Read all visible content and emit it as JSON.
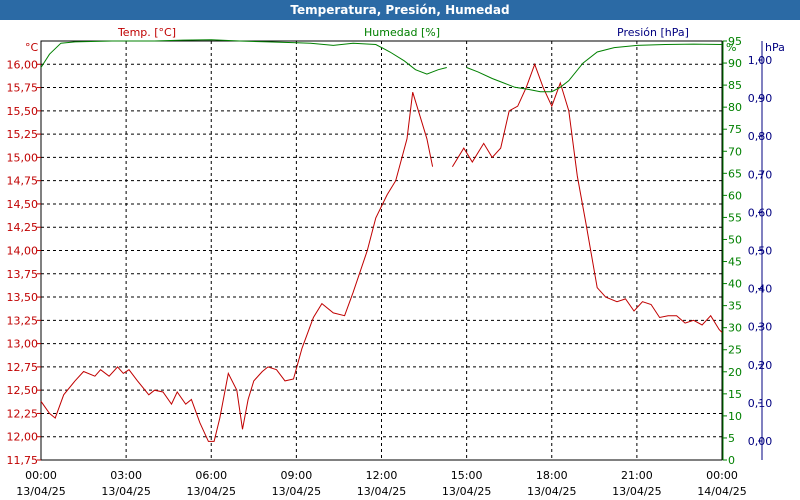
{
  "window": {
    "title": "Temperatura, Presión, Humedad"
  },
  "legend": {
    "temp": "Temp. [°C]",
    "hum": "Humedad [%]",
    "pres": "Presión [hPa]"
  },
  "units": {
    "temp": "°C",
    "hum": "%",
    "pres": "hPa"
  },
  "colors": {
    "temp": "#c00000",
    "hum": "#008000",
    "pres": "#000080",
    "title_bg": "#2b6aa5",
    "grid": "#000000"
  },
  "chart_data": {
    "type": "line",
    "title": "Temperatura, Presión, Humedad",
    "x_ticks": [
      {
        "time": "00:00",
        "date": "13/04/25"
      },
      {
        "time": "03:00",
        "date": "13/04/25"
      },
      {
        "time": "06:00",
        "date": "13/04/25"
      },
      {
        "time": "09:00",
        "date": "13/04/25"
      },
      {
        "time": "12:00",
        "date": "13/04/25"
      },
      {
        "time": "15:00",
        "date": "13/04/25"
      },
      {
        "time": "18:00",
        "date": "13/04/25"
      },
      {
        "time": "21:00",
        "date": "13/04/25"
      },
      {
        "time": "00:00",
        "date": "14/04/25"
      }
    ],
    "xlim_hours": [
      0,
      24
    ],
    "y_left": {
      "label": "Temp. [°C]",
      "unit": "°C",
      "lim": [
        11.75,
        16.25
      ],
      "ticks": [
        "11,75",
        "12,00",
        "12,25",
        "12,50",
        "12,75",
        "13,00",
        "13,25",
        "13,50",
        "13,75",
        "14,00",
        "14,25",
        "14,50",
        "14,75",
        "15,00",
        "15,25",
        "15,50",
        "15,75",
        "16,00"
      ]
    },
    "y_right1": {
      "label": "Humedad [%]",
      "unit": "%",
      "lim": [
        0,
        95
      ],
      "ticks": [
        "0",
        "5",
        "10",
        "15",
        "20",
        "25",
        "30",
        "35",
        "40",
        "45",
        "50",
        "55",
        "60",
        "65",
        "70",
        "75",
        "80",
        "85",
        "90",
        "95"
      ]
    },
    "y_right2": {
      "label": "Presión [hPa]",
      "unit": "hPa",
      "ticks": [
        "0,00",
        "0,10",
        "0,20",
        "0,30",
        "0,40",
        "0,50",
        "0,60",
        "0,70",
        "0,80",
        "0,90",
        "1,00"
      ]
    },
    "series": [
      {
        "name": "Temp. [°C]",
        "axis": "temp",
        "segments": [
          [
            [
              0.0,
              12.38
            ],
            [
              0.3,
              12.25
            ],
            [
              0.5,
              12.2
            ],
            [
              0.8,
              12.45
            ],
            [
              1.2,
              12.6
            ],
            [
              1.5,
              12.7
            ],
            [
              1.9,
              12.65
            ],
            [
              2.1,
              12.72
            ],
            [
              2.4,
              12.65
            ],
            [
              2.7,
              12.75
            ],
            [
              2.9,
              12.68
            ],
            [
              3.1,
              12.72
            ],
            [
              3.4,
              12.6
            ],
            [
              3.8,
              12.45
            ],
            [
              4.0,
              12.5
            ],
            [
              4.3,
              12.48
            ],
            [
              4.6,
              12.35
            ],
            [
              4.8,
              12.48
            ],
            [
              5.1,
              12.35
            ],
            [
              5.3,
              12.4
            ],
            [
              5.6,
              12.15
            ],
            [
              5.9,
              11.95
            ],
            [
              6.1,
              11.95
            ],
            [
              6.3,
              12.2
            ],
            [
              6.6,
              12.68
            ],
            [
              6.9,
              12.5
            ],
            [
              7.1,
              12.08
            ],
            [
              7.3,
              12.4
            ],
            [
              7.5,
              12.6
            ],
            [
              7.8,
              12.7
            ],
            [
              8.0,
              12.75
            ],
            [
              8.3,
              12.72
            ],
            [
              8.6,
              12.6
            ],
            [
              8.9,
              12.62
            ],
            [
              9.2,
              12.95
            ],
            [
              9.6,
              13.28
            ],
            [
              9.9,
              13.43
            ],
            [
              10.3,
              13.33
            ],
            [
              10.7,
              13.3
            ],
            [
              11.0,
              13.55
            ],
            [
              11.5,
              14.0
            ],
            [
              11.8,
              14.35
            ],
            [
              12.2,
              14.6
            ],
            [
              12.5,
              14.75
            ],
            [
              12.9,
              15.2
            ],
            [
              13.1,
              15.7
            ],
            [
              13.3,
              15.5
            ],
            [
              13.6,
              15.2
            ],
            [
              13.8,
              14.9
            ]
          ],
          [
            [
              14.5,
              14.9
            ],
            [
              14.9,
              15.1
            ],
            [
              15.2,
              14.95
            ],
            [
              15.6,
              15.15
            ],
            [
              15.9,
              15.0
            ],
            [
              16.2,
              15.1
            ],
            [
              16.5,
              15.5
            ],
            [
              16.8,
              15.55
            ],
            [
              17.1,
              15.75
            ],
            [
              17.4,
              16.0
            ],
            [
              17.7,
              15.75
            ],
            [
              18.0,
              15.55
            ],
            [
              18.3,
              15.8
            ],
            [
              18.6,
              15.5
            ],
            [
              18.9,
              14.8
            ],
            [
              19.2,
              14.3
            ],
            [
              19.6,
              13.6
            ],
            [
              19.9,
              13.5
            ],
            [
              20.3,
              13.45
            ],
            [
              20.6,
              13.48
            ],
            [
              20.9,
              13.35
            ],
            [
              21.2,
              13.45
            ],
            [
              21.5,
              13.42
            ],
            [
              21.8,
              13.28
            ],
            [
              22.1,
              13.3
            ],
            [
              22.4,
              13.3
            ],
            [
              22.7,
              13.22
            ],
            [
              23.0,
              13.25
            ],
            [
              23.3,
              13.2
            ],
            [
              23.6,
              13.3
            ],
            [
              23.9,
              13.15
            ],
            [
              24.0,
              13.12
            ]
          ]
        ]
      },
      {
        "name": "Humedad [%]",
        "axis": "hum",
        "segments": [
          [
            [
              0.0,
              89
            ],
            [
              0.3,
              92
            ],
            [
              0.7,
              94.5
            ],
            [
              1.2,
              94.8
            ],
            [
              2.5,
              95
            ],
            [
              4.0,
              95
            ],
            [
              5.0,
              95.2
            ],
            [
              6.0,
              95.3
            ],
            [
              7.0,
              95
            ],
            [
              8.0,
              94.8
            ],
            [
              9.0,
              94.6
            ],
            [
              9.5,
              94.5
            ],
            [
              10.3,
              94
            ],
            [
              11.0,
              94.5
            ],
            [
              11.8,
              94.2
            ],
            [
              12.3,
              92.5
            ],
            [
              12.8,
              90.5
            ],
            [
              13.2,
              88.5
            ],
            [
              13.6,
              87.5
            ],
            [
              14.0,
              88.5
            ],
            [
              14.3,
              89
            ]
          ],
          [
            [
              15.0,
              89
            ],
            [
              15.4,
              88
            ],
            [
              15.9,
              86.5
            ],
            [
              16.3,
              85.5
            ],
            [
              16.7,
              84.5
            ],
            [
              17.2,
              84
            ],
            [
              17.6,
              83.5
            ],
            [
              18.0,
              83.5
            ],
            [
              18.3,
              84.5
            ],
            [
              18.6,
              86
            ],
            [
              19.1,
              90
            ],
            [
              19.6,
              92.5
            ],
            [
              20.2,
              93.5
            ],
            [
              21.0,
              94
            ],
            [
              22.0,
              94.2
            ],
            [
              23.0,
              94.3
            ],
            [
              24.0,
              94.2
            ]
          ]
        ]
      }
    ],
    "grid": true,
    "legend_position": "top"
  }
}
